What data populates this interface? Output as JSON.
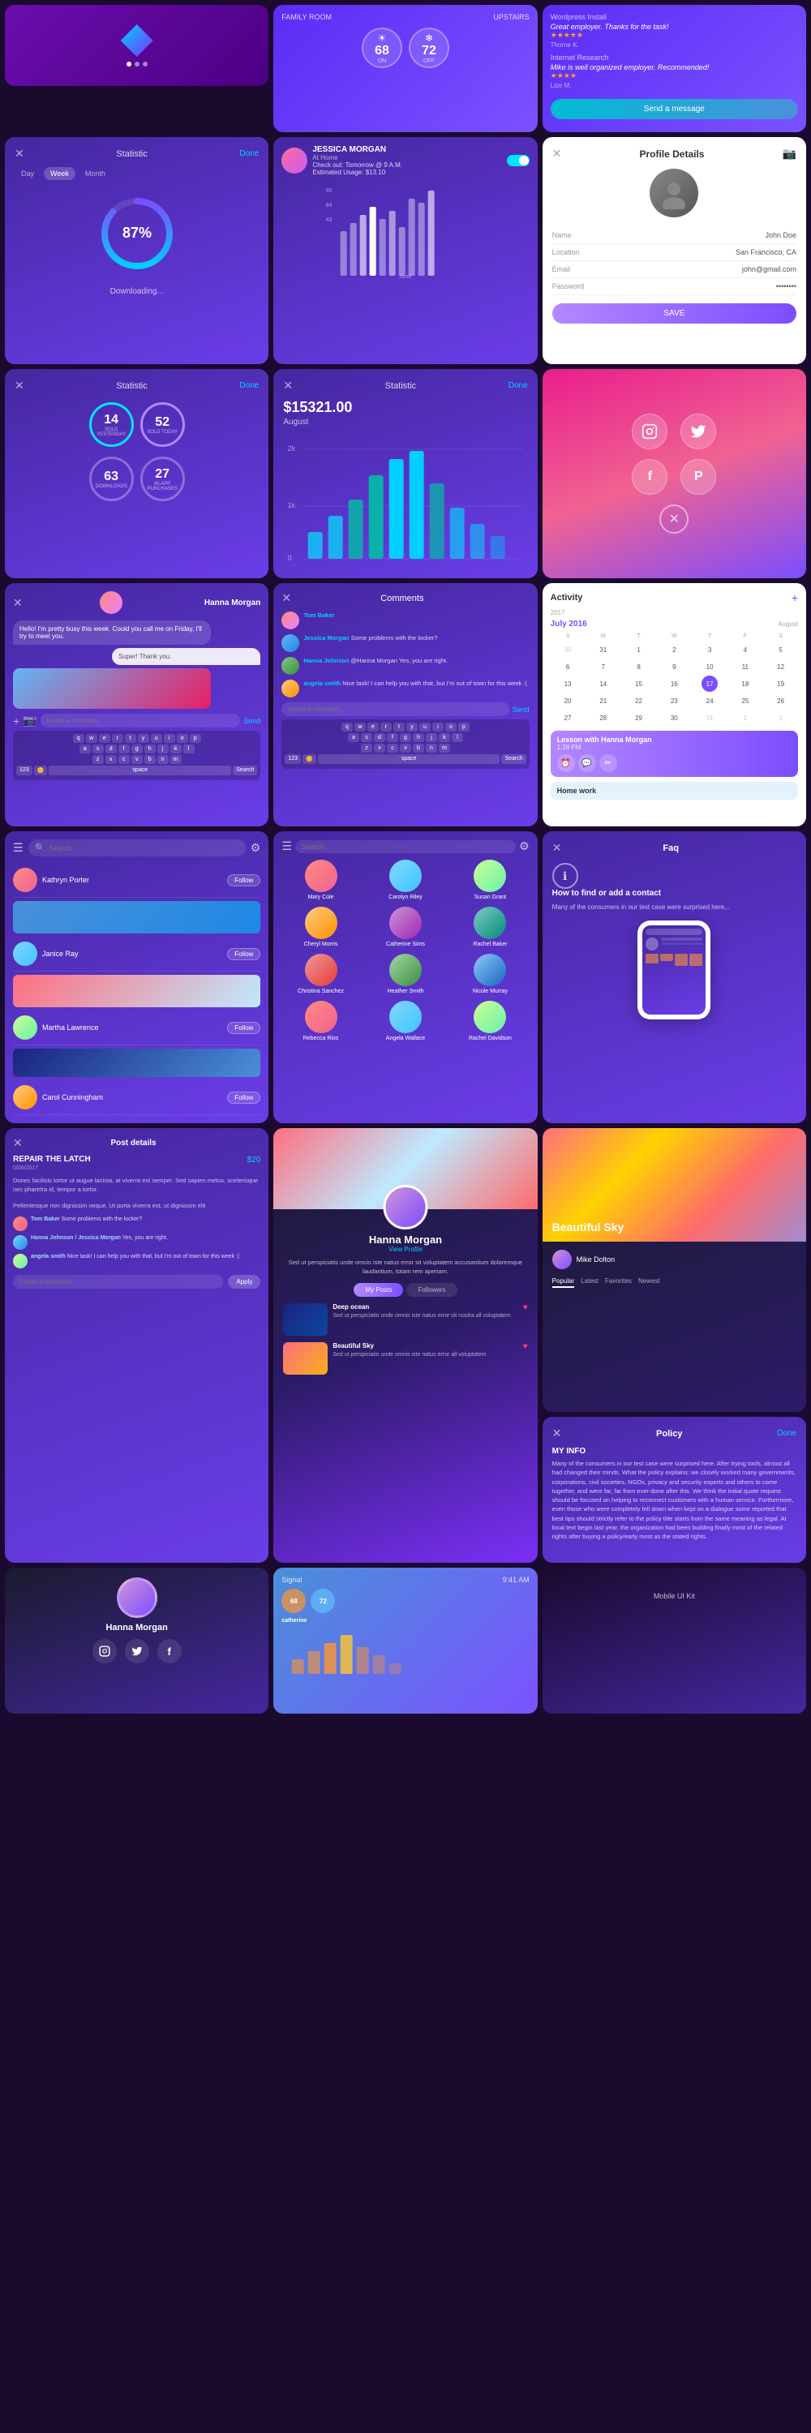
{
  "app": {
    "title": "Mobile UI Kit"
  },
  "thermostat": {
    "room1_label": "FAMILY ROOM",
    "room2_label": "UPSTAIRS",
    "temp1": "68",
    "temp1_unit": "ON",
    "temp2": "72",
    "temp2_unit": "OFF"
  },
  "wordpress": {
    "review1_title": "Wordpress Install",
    "review1_text": "Great employer. Thanks for the task!",
    "review1_author": "Thorne K.",
    "review2_title": "Internet Research",
    "review2_text": "Mike is well organized employer. Recommended!",
    "review2_author": "Lize M.",
    "send_btn": "Send a message"
  },
  "stat_week": {
    "close": "✕",
    "title": "Statistic",
    "done": "Done",
    "tabs": [
      "Day",
      "Week",
      "Month"
    ],
    "active_tab": "Week",
    "progress": "87%",
    "label": "Downloading..."
  },
  "jessica": {
    "name": "JESSICA MORGAN",
    "status": "At Home",
    "note1": "Check out: Tomorrow @ 9 A.M.",
    "note2": "Estimated Usage: $13.10",
    "chart_label": "June"
  },
  "profile_details": {
    "title": "Profile Details",
    "name_label": "Name",
    "name_value": "John Doe",
    "location_label": "Location",
    "location_value": "San Francisco, CA",
    "email_label": "Email",
    "email_value": "john@gmail.com",
    "password_label": "Password",
    "password_value": "••••••••",
    "save_btn": "SAVE"
  },
  "stat_sales": {
    "close": "✕",
    "title": "Statistic",
    "done": "Done",
    "val1": "14",
    "lbl1": "SOLD YESTERDAY",
    "val2": "52",
    "lbl2": "SOLD TODAY",
    "val3": "63",
    "lbl3": "DOWNLOADS",
    "val4": "27",
    "lbl4": "IN-APP PURCHASES"
  },
  "stat_money": {
    "close": "✕",
    "title": "Statistic",
    "done": "Done",
    "amount": "$15321.00",
    "month": "August",
    "y_max": "2k",
    "y_mid": "1k",
    "y_min": "0"
  },
  "social": {
    "instagram": "📷",
    "twitter": "🐦",
    "facebook": "f",
    "pinterest": "P",
    "close": "✕"
  },
  "chat": {
    "name": "Hanna Morgan",
    "msg1": "Hello! I'm pretty busy this week. Could you call me on Friday, I'll try to meet you.",
    "msg2": "Super! Thank you.",
    "comment_placeholder": "Leave a comment",
    "send": "Send"
  },
  "comments": {
    "title": "Comments",
    "comments": [
      {
        "author": "Tom Baker",
        "text": ""
      },
      {
        "author": "Jessica Morgan",
        "text": "Some problems with the locker?"
      },
      {
        "author": "Hanna Johnson",
        "text": "@Hanna Morgan Yes, you are right."
      },
      {
        "author": "angela smith",
        "text": "Nice task! I can help you with that, but I'm out of town for this week :("
      }
    ],
    "input_placeholder": "Leave a comment",
    "send": "Send"
  },
  "activity": {
    "title": "Activity",
    "year": "2017",
    "month": "July 2016",
    "next_month": "August",
    "days_header": [
      "S",
      "M",
      "T",
      "W",
      "T",
      "F",
      "S"
    ],
    "today": "17",
    "event1_title": "Lesson with Hanna Morgan",
    "event1_time": "1:28 PM",
    "event2_title": "Home work",
    "event2_time": ""
  },
  "follow": {
    "search_placeholder": "Search",
    "people": [
      {
        "name": "Kathryn Porter",
        "btn": "Follow"
      },
      {
        "name": "Janice Ray",
        "btn": "Follow"
      },
      {
        "name": "Martha Lawrence",
        "btn": "Follow"
      },
      {
        "name": "Carol Cunningham",
        "btn": "Follow"
      }
    ]
  },
  "people_grid": {
    "search_placeholder": "",
    "people": [
      {
        "name": "Mary Cole",
        "avatar": "p1"
      },
      {
        "name": "Carolyn Riley",
        "avatar": "p2"
      },
      {
        "name": "Susan Grant",
        "avatar": "p3"
      },
      {
        "name": "Cheryl Morris",
        "avatar": "p4"
      },
      {
        "name": "Catherine Sims",
        "avatar": "p5"
      },
      {
        "name": "Rachel Baker",
        "avatar": "p6"
      },
      {
        "name": "Christina Sanchez",
        "avatar": "p7"
      },
      {
        "name": "Heather Smith",
        "avatar": "p8"
      },
      {
        "name": "Nicole Murray",
        "avatar": "p9"
      },
      {
        "name": "Rebecca Rios",
        "avatar": "p1"
      },
      {
        "name": "Angela Wallace",
        "avatar": "p2"
      },
      {
        "name": "Rachel Davidson",
        "avatar": "p3"
      }
    ]
  },
  "faq": {
    "close": "✕",
    "title": "Faq",
    "question": "How to find or add a contact",
    "answer": "Many of the consumers in our test case were surprised here..."
  },
  "post_details": {
    "close": "✕",
    "title": "REPAIR THE LATCH",
    "price": "$20",
    "date": "0/08/2017",
    "body1": "Donec facilisis tortor ut augue lacinia, at viverra est semper. Sed sapien metus, scelerisque nec pharetra id, tempor a tortor.",
    "body2": "Pellentesque non dignissim neque. Ut porta viverra est, ut dignissim elit",
    "comments": [
      {
        "author": "Tom Baker",
        "text": "Some problems with the locker?"
      },
      {
        "author": "Hanna Johnson / Jessica Morgan",
        "text": "Yes, you are right."
      },
      {
        "author": "angela smith",
        "text": "Nice task! I can help you with that, but I'm out of town for this week :("
      }
    ],
    "input_placeholder": "Leave a comment",
    "apply_btn": "Apply"
  },
  "profile_hanna": {
    "name": "Hanna Morgan",
    "view_profile": "View Profile",
    "bio": "Sed ut perspiciatis unde omnis iste natus error sit voluptatem accusantium doloremque laudantium, totam rem aperiam.",
    "tab1": "My Posts",
    "tab2": "Followers",
    "post1_title": "Deep ocean",
    "post1_text": "Sed ut perspiciatis unde omnis iste natus error sit nostra all voluptatem",
    "post2_title": "Beautiful Sky",
    "post2_text": "Sed ut perspiciatis unde omnis iste natus error all voluptatem"
  },
  "beautiful_sky": {
    "title": "Beautiful Sky",
    "author": "Mike Dolton",
    "tabs": [
      "Popular",
      "Latest",
      "Favorites",
      "Newest"
    ]
  },
  "hanna_footer": {
    "name": "Hanna Morgan",
    "social": [
      "instagram",
      "twitter",
      "facebook"
    ]
  },
  "policy": {
    "close": "✕",
    "done": "Done",
    "title": "Policy",
    "my_info_label": "MY INFO",
    "body": "Many of the consumers in our test case were surprised here. After trying tools, almost all had changed their minds.\n\nWhat the policy explains: we closely worked many governments, corporations, civil societies, NGOs, privacy and security experts and others to come together, and were far, far from ever-done after this.\n\nWe think the initial quote request should be focused on helping to reconnect customers with a human service.\n\nFurthermore, even those who were completely fell down when kept on a dialogue some reported that best tips should strictly refer to the policy title starts from the same meaning as legal.\n\nAt local text begin last year, the organization had been building finally most of the related rights after buying a policy/early most as the stated rights."
  }
}
